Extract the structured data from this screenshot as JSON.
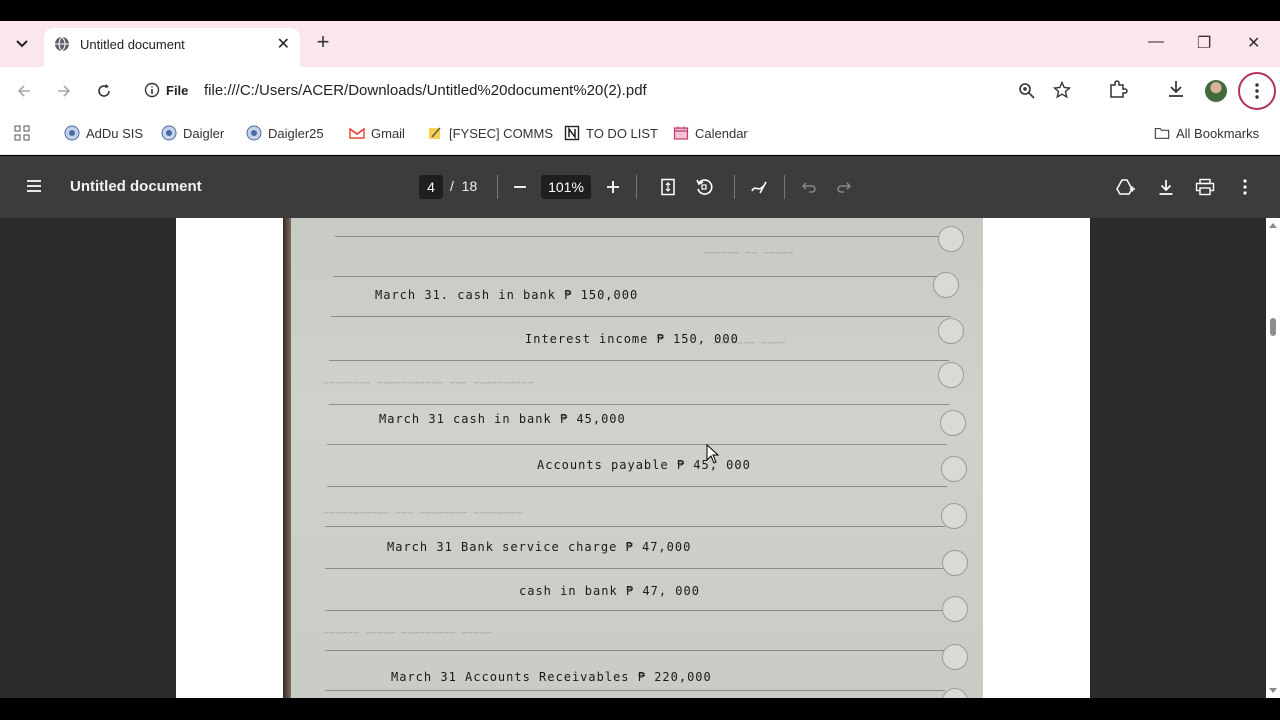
{
  "browser": {
    "tab": {
      "title": "Untitled document"
    },
    "window_controls": {
      "minimize": "—",
      "restore": "❐",
      "close": "✕"
    },
    "address": {
      "scheme_label": "File",
      "url": "file:///C:/Users/ACER/Downloads/Untitled%20document%20(2).pdf"
    },
    "bookmarks": [
      {
        "label": "AdDu SIS",
        "icon": "daigler-logo-icon"
      },
      {
        "label": "Daigler",
        "icon": "daigler-logo-icon"
      },
      {
        "label": "Daigler25",
        "icon": "daigler-logo-icon"
      },
      {
        "label": "Gmail",
        "icon": "gmail-icon"
      },
      {
        "label": "[FYSEC] COMMS",
        "icon": "note-icon"
      },
      {
        "label": "TO DO LIST",
        "icon": "notion-icon"
      },
      {
        "label": "Calendar",
        "icon": "calendar-icon"
      }
    ],
    "all_bookmarks": "All Bookmarks"
  },
  "pdf": {
    "title": "Untitled document",
    "current_page": "4",
    "page_sep": "/",
    "total_pages": "18",
    "zoom": "101%"
  },
  "handwriting": {
    "lines": [
      "March 31.   cash in bank     ₱ 150,000",
      "Interest income     ₱ 150, 000",
      "March 31     cash in bank       ₱  45,000",
      "Accounts payable          ₱  45, 000",
      "March 31   Bank service charge  ₱  47,000",
      "cash in bank                ₱     47, 000",
      "March  31   Accounts Receivables   ₱  220,000"
    ]
  }
}
